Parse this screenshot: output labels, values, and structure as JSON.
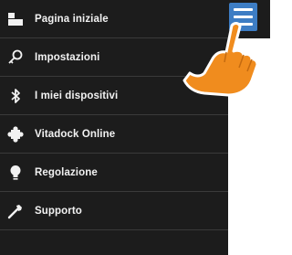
{
  "menu": {
    "items": [
      {
        "label": "Pagina iniziale",
        "icon": "home-icon"
      },
      {
        "label": "Impostazioni",
        "icon": "settings-key-icon"
      },
      {
        "label": "I miei dispositivi",
        "icon": "bluetooth-icon"
      },
      {
        "label": "Vitadock Online",
        "icon": "puzzle-icon"
      },
      {
        "label": "Regolazione",
        "icon": "lightbulb-icon"
      },
      {
        "label": "Supporto",
        "icon": "wrench-icon"
      }
    ]
  },
  "header": {
    "menu_button_icon": "hamburger-menu-icon"
  },
  "colors": {
    "menu_background": "#1c1c1c",
    "menu_text": "#f2f2f2",
    "accent": "#3d7dc4",
    "pointer_hand": "#f08c1e"
  }
}
